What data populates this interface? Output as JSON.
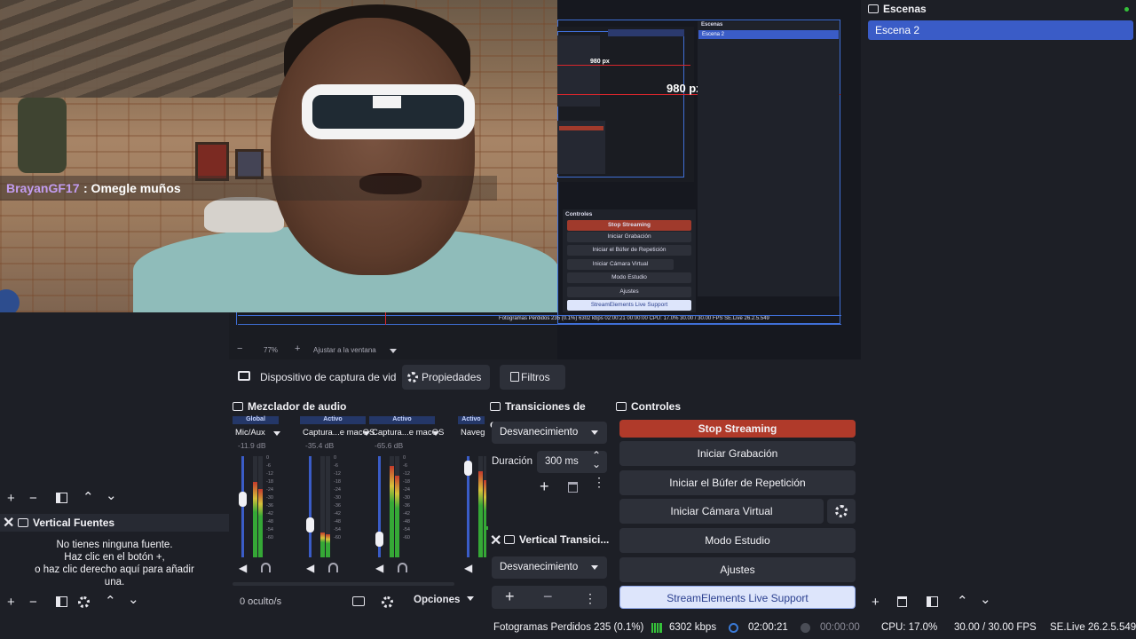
{
  "stream_overlay": {
    "chat_user": "BrayanGF17",
    "chat_message": ": Omegle muños"
  },
  "nested_preview": {
    "width_label_big": "980 px",
    "width_label_small": "980 px",
    "scenes_title": "Escenas",
    "scene_item": "Escena 2",
    "controls_title": "Controles",
    "buttons": [
      "Stop Streaming",
      "Iniciar Grabación",
      "Iniciar el Búfer de Repetición",
      "Iniciar Cámara Virtual",
      "Modo Estudio",
      "Ajustes",
      "StreamElements Live Support"
    ],
    "status": "Fotogramas Perdidos 235 (0.1%)   6302 kbps   02:00:21   00:00:00   CPU: 17.0%   30.00 / 30.00 FPS   SE.Live 26.2.5.549"
  },
  "zoom_bar": {
    "minus": "−",
    "zoom": "77%",
    "plus": "+",
    "fit": "Ajustar a la ventana"
  },
  "source_toolbar": {
    "source_name": "Dispositivo de captura de vid",
    "properties": "Propiedades",
    "filters": "Filtros"
  },
  "scenes": {
    "title": "Escenas",
    "items": [
      "Escena 2"
    ]
  },
  "vertical_sources": {
    "title": "Vertical Fuentes",
    "empty_line1": "No tienes ninguna fuente.",
    "empty_line2": "Haz clic en el botón +,",
    "empty_line3": "o haz clic derecho aquí para añadir",
    "empty_line4": "una."
  },
  "audio_mixer": {
    "title": "Mezclador de audio",
    "channels": [
      {
        "status": "Global",
        "name": "Mic/Aux",
        "db": "-11.9 dB",
        "level": 0.75,
        "volume": 0.62
      },
      {
        "status": "Activo",
        "name": "Captura...e macOS",
        "db": "-35.4 dB",
        "level": 0.25,
        "volume": 0.35
      },
      {
        "status": "Activo",
        "name": "Captura...e macOS",
        "db": "-65.6 dB",
        "level": 0.9,
        "volume": 0.2
      },
      {
        "status": "Activo",
        "name": "Naveg",
        "db": "",
        "level": 0.85,
        "volume": 0.95
      }
    ],
    "scale": [
      "0",
      "-6",
      "-12",
      "-18",
      "-24",
      "-30",
      "-36",
      "-42",
      "-48",
      "-54",
      "-60"
    ],
    "hidden": "0 oculto/s",
    "options": "Opciones"
  },
  "transitions": {
    "title": "Transiciones de esc...",
    "selected": "Desvanecimiento",
    "duration_label": "Duración",
    "duration_value": "300 ms"
  },
  "vertical_transitions": {
    "title": "Vertical Transici...",
    "selected": "Desvanecimiento"
  },
  "controls": {
    "title": "Controles",
    "stop_streaming": "Stop Streaming",
    "start_recording": "Iniciar Grabación",
    "replay_buffer": "Iniciar el Búfer de Repetición",
    "virtual_camera": "Iniciar Cámara Virtual",
    "studio_mode": "Modo Estudio",
    "settings": "Ajustes",
    "live_support": "StreamElements Live Support"
  },
  "status_bar": {
    "dropped_frames": "Fotogramas Perdidos 235 (0.1%)",
    "bitrate": "6302 kbps",
    "stream_time": "02:00:21",
    "record_time": "00:00:00",
    "cpu": "CPU: 17.0%",
    "fps": "30.00 / 30.00 FPS",
    "version": "SE.Live 26.2.5.549"
  },
  "colors": {
    "accent": "#3a5cc7",
    "stop_red": "#b03a2a",
    "support_bg": "#dde5fb",
    "support_text": "#2a3f8f",
    "bitrate_green": "#35c23a"
  }
}
